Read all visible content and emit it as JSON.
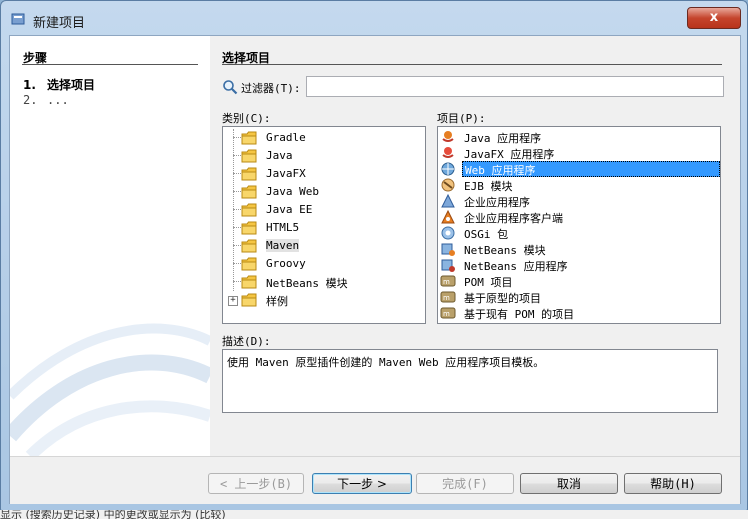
{
  "window": {
    "title": "新建项目",
    "close_label": "x"
  },
  "steps": {
    "header": "步骤",
    "items": [
      {
        "num": "1.",
        "label": "选择项目"
      },
      {
        "num": "2.",
        "label": "..."
      }
    ]
  },
  "main": {
    "title": "选择项目",
    "filter_label": "过滤器(T):",
    "filter_value": "",
    "categories_label": "类别(C):",
    "projects_label": "项目(P):",
    "categories": [
      {
        "label": "Gradle"
      },
      {
        "label": "Java"
      },
      {
        "label": "JavaFX"
      },
      {
        "label": "Java Web"
      },
      {
        "label": "Java EE"
      },
      {
        "label": "HTML5"
      },
      {
        "label": "Maven",
        "selected": true
      },
      {
        "label": "Groovy"
      },
      {
        "label": "NetBeans 模块"
      },
      {
        "label": "样例",
        "expander": "+"
      }
    ],
    "projects": [
      {
        "label": "Java 应用程序",
        "icon": "java-app-icon"
      },
      {
        "label": "JavaFX 应用程序",
        "icon": "javafx-app-icon"
      },
      {
        "label": "Web 应用程序",
        "icon": "web-app-icon",
        "selected": true
      },
      {
        "label": "EJB 模块",
        "icon": "ejb-module-icon"
      },
      {
        "label": "企业应用程序",
        "icon": "enterprise-app-icon"
      },
      {
        "label": "企业应用程序客户端",
        "icon": "enterprise-client-icon"
      },
      {
        "label": "OSGi 包",
        "icon": "osgi-bundle-icon"
      },
      {
        "label": "NetBeans 模块",
        "icon": "netbeans-module-icon"
      },
      {
        "label": "NetBeans 应用程序",
        "icon": "netbeans-app-icon"
      },
      {
        "label": "POM 项目",
        "icon": "maven-pom-icon"
      },
      {
        "label": "基于原型的项目",
        "icon": "maven-archetype-icon"
      },
      {
        "label": "基于现有 POM 的项目",
        "icon": "maven-existing-pom-icon"
      }
    ],
    "description_label": "描述(D):",
    "description": "使用 Maven 原型插件创建的 Maven Web 应用程序项目模板。"
  },
  "buttons": {
    "back": "< 上一步(B)",
    "next": "下一步 >",
    "finish": "完成(F)",
    "cancel": "取消",
    "help": "帮助(H)"
  },
  "status_text": "显示 (搜索历史记录) 中的更改或显示为 (比较)",
  "colors": {
    "selection": "#3399ff",
    "window_frame": "#a9c6e3",
    "close_button": "#c5452d"
  }
}
